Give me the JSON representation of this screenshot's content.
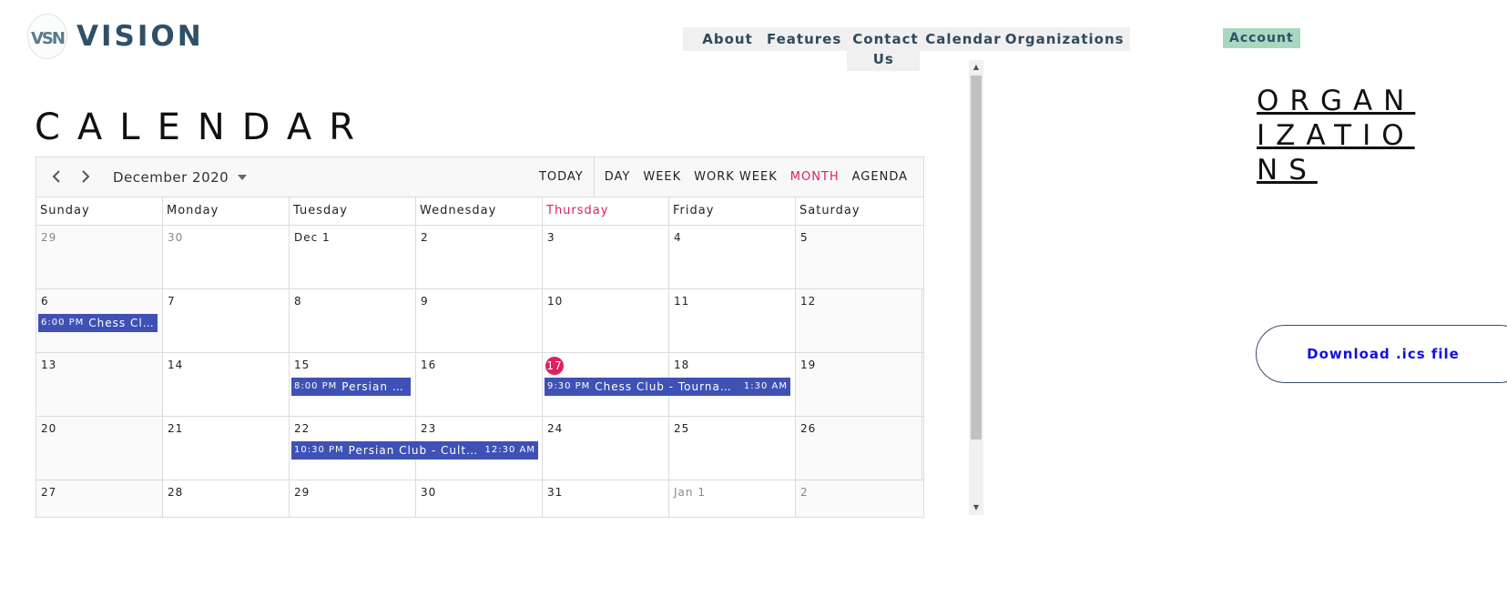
{
  "brand": {
    "logo_text": "VISION",
    "logo_mark": "VSN"
  },
  "nav": {
    "items": [
      "About",
      "Features",
      "Contact Us",
      "Calendar",
      "Organizations"
    ],
    "account": "Account"
  },
  "page": {
    "title": "CALENDAR"
  },
  "calendar": {
    "month_label": "December 2020",
    "today_button": "TODAY",
    "views": [
      "DAY",
      "WEEK",
      "WORK WEEK",
      "MONTH",
      "AGENDA"
    ],
    "active_view": "MONTH",
    "days_of_week": [
      "Sunday",
      "Monday",
      "Tuesday",
      "Wednesday",
      "Thursday",
      "Friday",
      "Saturday"
    ],
    "today_dow": "Thursday",
    "weeks": [
      [
        "29",
        "30",
        "Dec 1",
        "2",
        "3",
        "4",
        "5"
      ],
      [
        "6",
        "7",
        "8",
        "9",
        "10",
        "11",
        "12"
      ],
      [
        "13",
        "14",
        "15",
        "16",
        "17",
        "18",
        "19"
      ],
      [
        "20",
        "21",
        "22",
        "23",
        "24",
        "25",
        "26"
      ],
      [
        "27",
        "28",
        "29",
        "30",
        "31",
        "Jan 1",
        "2"
      ]
    ],
    "today_date": "17",
    "events": [
      {
        "start": "6:00 PM",
        "title": "Chess Clu…",
        "end": ""
      },
      {
        "start": "8:00 PM",
        "title": "Persian C…",
        "end": ""
      },
      {
        "start": "9:30 PM",
        "title": "Chess Club - Tourname…",
        "end": "1:30 AM"
      },
      {
        "start": "10:30 PM",
        "title": "Persian Club - Cultur…",
        "end": "12:30 AM"
      }
    ],
    "colors": {
      "event": "#3f51b5",
      "today": "#e01f5f"
    }
  },
  "sidebar": {
    "title": "ORGANIZATIONS",
    "download_label": "Download .ics file"
  }
}
